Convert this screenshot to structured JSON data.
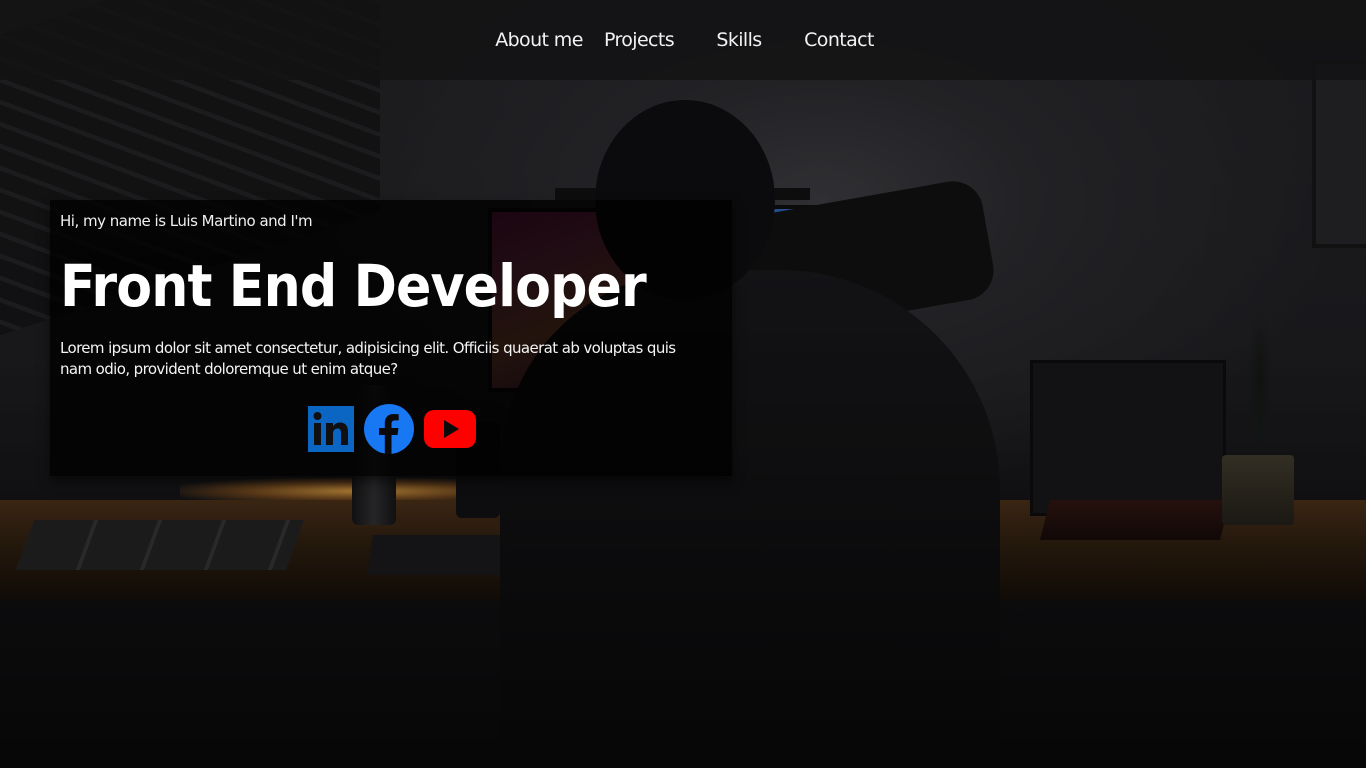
{
  "nav": {
    "links": [
      {
        "label": "About me"
      },
      {
        "label": "Projects"
      },
      {
        "label": "Skills"
      },
      {
        "label": "Contact"
      }
    ]
  },
  "hero": {
    "greeting": "Hi, my name is Luis Martino and I'm",
    "title": "Front End Developer",
    "description": "Lorem ipsum dolor sit amet consectetur, adipisicing elit. Officiis quaerat ab voluptas quis nam odio, provident doloremque ut enim atque?",
    "socials": [
      {
        "icon": "linkedin-icon",
        "color": "#0a66c2"
      },
      {
        "icon": "facebook-icon",
        "color": "#1877f2"
      },
      {
        "icon": "youtube-icon",
        "color": "#ff0000"
      }
    ]
  },
  "colors": {
    "nav_background": "#121214",
    "hero_background": "#000000",
    "text": "#ffffff"
  }
}
